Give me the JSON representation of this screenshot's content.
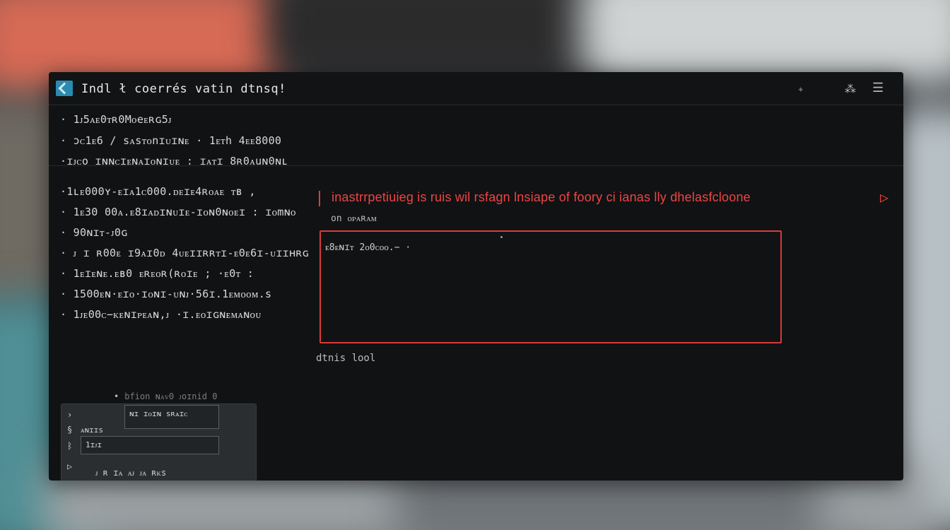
{
  "window": {
    "title": "Indl ł   coerrés  vatin   dtnsq!",
    "toolbar_icons": [
      "sparkle-icon",
      "pin-icon",
      "menu-icon"
    ]
  },
  "log_lines": [
    "· 1ᴊ5ᴀᴇ0ᴛʀ0Mᴏeᴇʀɢ5ᴊ",
    "· ɔᴄ1ᴇ6 / sᴀsᴛᴏnɪᴜɪɴᴇ · 1ᴇᴛh 4ᴇᴇ8000",
    "·ɪᴊᴄo ɪɴɴᴄɪᴇɴᴀɪᴏɴɪᴜᴇ :  ɪᴀᴛɪ 8ʀ0ᴀuɴ0ɴʟ",
    "·1ʟᴇ000ʏ-ᴇɪᴀ1ᴄ000.ᴅᴇɪᴇ4ʀᴏᴀᴇ ᴛʙ ,",
    "· 1ᴇ30 00ᴀ.ᴇ8ɪᴀᴅɪɴᴜɪᴇ-ɪᴏɴ0ɴᴏᴇɪ : ɪᴏmɴᴏ",
    "· 90ɴɪᴛ-ᴊ0ɢ",
    "· ᴊ ɪ ʀ00ᴇ ɪ9ᴀɪ0ᴅ 4ᴜᴇɪɪʀʀᴛɪ-ᴇ0ᴇ6ɪ-ᴜɪɪʜʀɢ",
    "· 1ᴇɪᴇɴᴇ.ᴇʙ0  ᴇʀᴇᴏʀ(ʀᴏɪᴇ ; ·ᴇ0ᴛ :",
    "· 1500ᴇɴ·ᴇɪᴏ·ɪᴏɴɪ-ᴜɴᴊ·56ɪ.1ᴇᴍᴏᴏᴍ.s",
    "· 1ᴊᴇ00ᴄ−ᴋᴇɴɪᴘᴇᴀɴ,ᴊ ·ɪ.ᴇᴏɪɢɴᴇᴍᴀɴᴏᴜ"
  ],
  "error": {
    "message": "inastrrpetiuieg is ruis wil rsfagn lnsiape of foory  ci  ianas lly  dhelasfcloone",
    "sub": "on ᴏᴘᴀʀᴀᴍ",
    "box_text": "ᴇ8ᴇɴɪᴛ 2ᴏ0ᴄᴏᴏ.− ·",
    "status": "dtnis lool"
  },
  "mini_panel": {
    "hint": "bfion   ɴᴀᴠ0 ᴊoɪnid 0",
    "input1": "ɴɪ ɪᴏɪɴ sʀᴀɪᴄ",
    "label": "ᴀɴɪɪs",
    "input2": "1ɪᴊɪ",
    "footer": "ᴊ ʀ  ɪᴀ  ᴀᴊ ᴊᴀ ʀᴋs"
  }
}
